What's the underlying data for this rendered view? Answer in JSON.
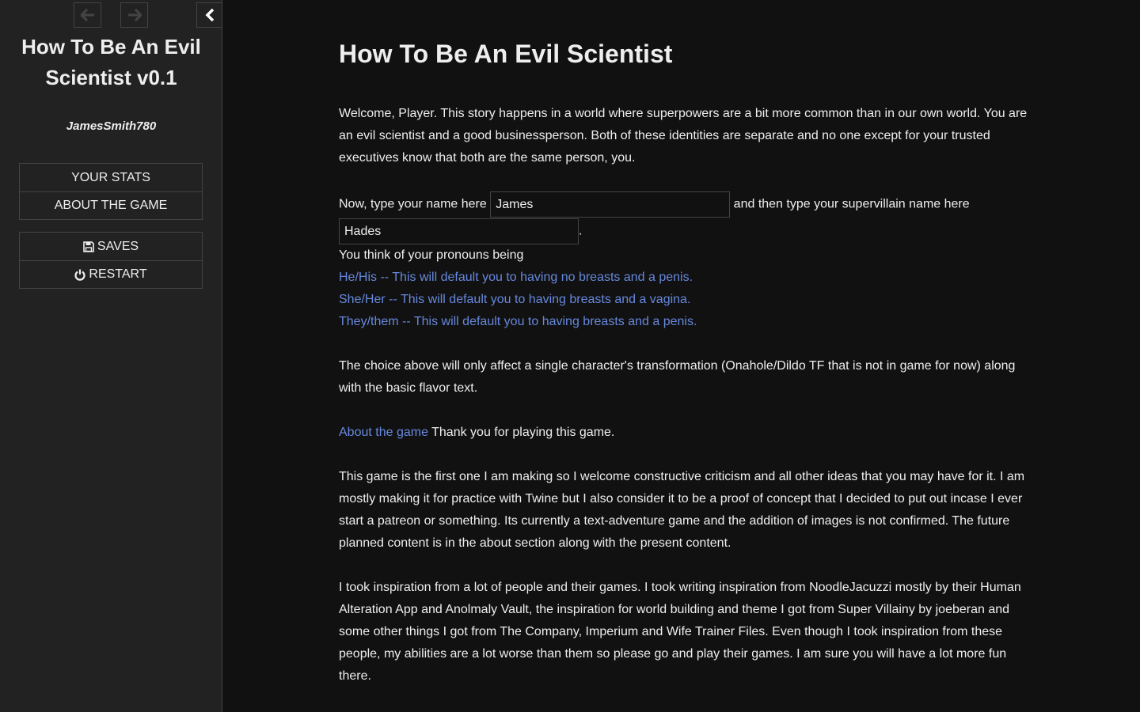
{
  "sidebar": {
    "history_back_icon": "arrow-left-icon",
    "history_forward_icon": "arrow-right-icon",
    "toggle_icon": "chevron-left-icon",
    "title": "How To Be An Evil Scientist v0.1",
    "author": "JamesSmith780",
    "story_menu": [
      {
        "label": "YOUR STATS"
      },
      {
        "label": "ABOUT THE GAME"
      }
    ],
    "core_menu": [
      {
        "label": "SAVES",
        "icon": "floppy-disk-icon"
      },
      {
        "label": "RESTART",
        "icon": "power-icon"
      }
    ]
  },
  "passage": {
    "title": "How To Be An Evil Scientist",
    "intro": "Welcome, Player. This story happens in a world where superpowers are a bit more common than in our own world. You are an evil scientist and a good businessperson. Both of these identities are separate and no one except for your trusted executives know that both are the same person, you.",
    "name_prompt": "Now, type your name here",
    "name_value": "James",
    "villain_prompt": "and then type your supervillain name here",
    "villain_value": "Hades",
    "period": ".",
    "pronoun_prompt": "You think of your pronouns being",
    "pronoun_options": [
      "He/His -- This will default you to having no breasts and a penis.",
      "She/Her -- This will default you to having breasts and a vagina.",
      "They/them -- This will default you to having breasts and a penis."
    ],
    "choice_note": "The choice above will only affect a single character's transformation (Onahole/Dildo TF that is not in game for now) along with the basic flavor text.",
    "about_link": "About the game",
    "thanks": " Thank you for playing this game.",
    "para_first_game": "This game is the first one I am making so I welcome constructive criticism and all other ideas that you may have for it. I am mostly making it for practice with Twine but I also consider it to be a proof of concept that I decided to put out incase I ever start a patreon or something. Its currently a text-adventure game and the addition of images is not confirmed. The future planned content is in the about section along with the present content.",
    "para_inspiration": "I took inspiration from a lot of people and their games. I took writing inspiration from NoodleJacuzzi mostly by their Human Alteration App and Anolmaly Vault, the inspiration for world building and theme I got from Super Villainy by joeberan and some other things I got from The Company, Imperium and Wife Trainer Files. Even though I took inspiration from these people, my abilities are a lot worse than them so please go and play their games. I am sure you will have a lot more fun there."
  },
  "colors": {
    "sidebar_bg": "#222222",
    "main_bg": "#111111",
    "text": "#eeeeee",
    "link": "#6688dd",
    "border": "#444444"
  }
}
